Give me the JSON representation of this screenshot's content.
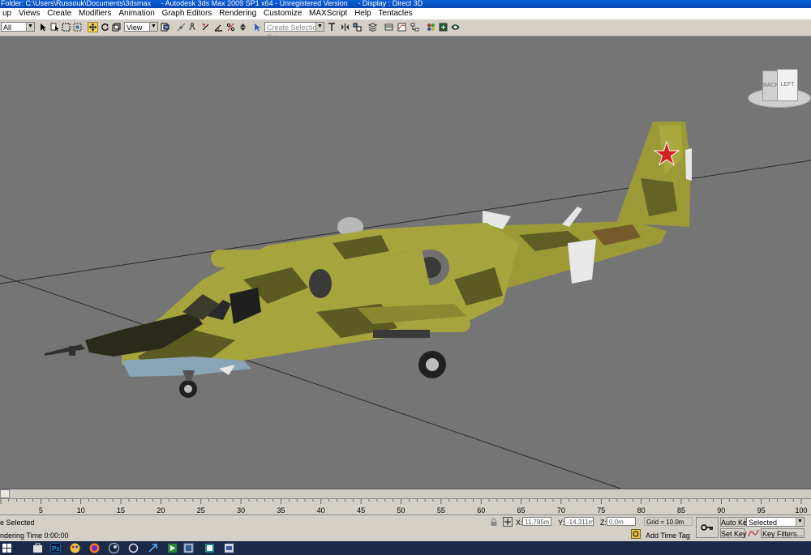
{
  "window": {
    "title_parts": [
      "Folder: C:\\Users\\Russouk\\Documents\\3dsmax",
      "- Autodesk 3ds Max  2009 SP1  x64  - Unregistered Version",
      "- Display : Direct 3D"
    ]
  },
  "menu": [
    "up",
    "Views",
    "Create",
    "Modifiers",
    "Animation",
    "Graph Editors",
    "Rendering",
    "Customize",
    "MAXScript",
    "Help",
    "Tentacles"
  ],
  "toolbar": {
    "filter_value": "All",
    "ref_coord_value": "View",
    "named_selection_placeholder": "Create Selection Set"
  },
  "viewport": {
    "viewcube_face_left": "LEFT",
    "viewcube_face_back": "BACK"
  },
  "colors": {
    "viewport_bg": "#757575",
    "camo_light": "#a6a43c",
    "camo_dark": "#5a5a22",
    "camo_brown": "#6b4a2a",
    "star_red": "#d42020"
  },
  "timeline": {
    "tick_labels": [
      "5",
      "10",
      "15",
      "20",
      "25",
      "30",
      "35",
      "40",
      "45",
      "50",
      "55",
      "60",
      "65",
      "70",
      "75",
      "80",
      "85",
      "90",
      "95",
      "100"
    ]
  },
  "status": {
    "selection": "e Selected",
    "rendering": "ndering Time  0:00:00",
    "x_label": "X:",
    "x_value": "11.785m",
    "y_label": "Y:",
    "y_value": "-14.311m",
    "z_label": "Z:",
    "z_value": "0.0m",
    "grid": "Grid = 10.0m",
    "add_time_tag": "Add Time Tag",
    "auto_key": "Auto Key",
    "auto_key_dropdown": "Selected",
    "set_key": "Set Key",
    "key_filters": "Key Filters..."
  },
  "taskbar": {
    "icons": [
      "start-icon",
      "store-icon",
      "photoshop-icon",
      "paint-icon",
      "firefox-icon",
      "steam-icon",
      "app-icon",
      "remote-desktop-icon",
      "media-icon",
      "window-icon",
      "3dsmax-icon",
      "3dsmax-icon-2",
      "app-icon-2"
    ]
  }
}
